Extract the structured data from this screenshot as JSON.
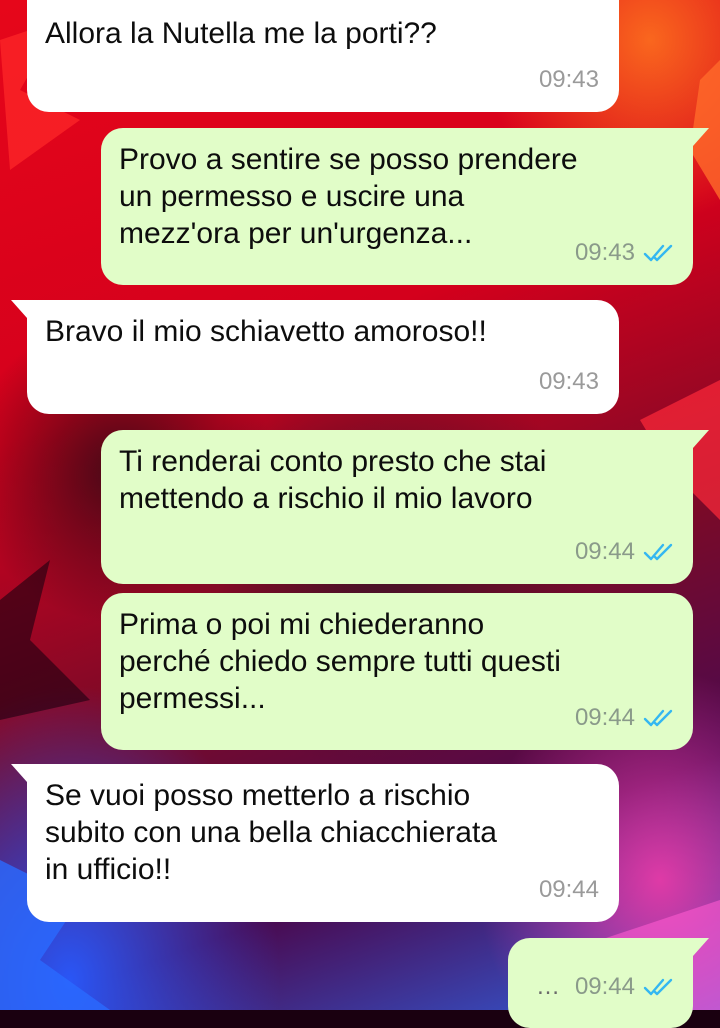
{
  "chat": {
    "messages": [
      {
        "direction": "in",
        "text": "Allora la Nutella me la porti??",
        "time": "09:43"
      },
      {
        "direction": "out",
        "text": "Provo a sentire se posso prendere\nun permesso e uscire una\nmezz'ora per un'urgenza...",
        "time": "09:43",
        "status_icon": "double-check-read"
      },
      {
        "direction": "in",
        "text": "Bravo il mio schiavetto amoroso!!",
        "time": "09:43"
      },
      {
        "direction": "out",
        "text": "Ti renderai conto presto che stai\nmettendo a rischio il mio lavoro",
        "time": "09:44",
        "status_icon": "double-check-read"
      },
      {
        "direction": "out",
        "text": "Prima o poi mi chiederanno\nperché chiedo sempre tutti questi\npermessi...",
        "time": "09:44",
        "status_icon": "double-check-read"
      },
      {
        "direction": "in",
        "text": "Se vuoi posso metterlo a rischio\nsubito con una bella chiacchierata\nin ufficio!!",
        "time": "09:44"
      },
      {
        "direction": "out",
        "text": "…",
        "time": "09:44",
        "status_icon": "double-check-read"
      }
    ]
  },
  "colors": {
    "incoming_bubble": "#ffffff",
    "outgoing_bubble": "#e1fdc8",
    "read_ticks": "#34b7f1"
  }
}
